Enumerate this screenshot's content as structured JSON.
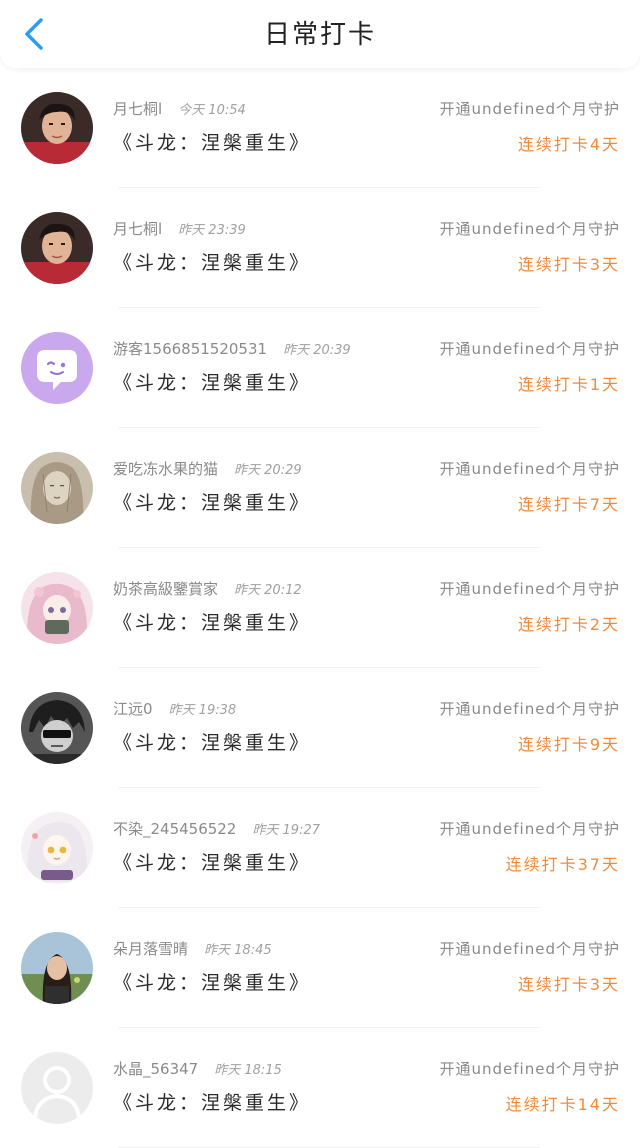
{
  "header": {
    "title": "日常打卡",
    "back_icon": "chevron-left-icon",
    "accent": "#2d9cf0"
  },
  "colors": {
    "streak": "#f08a3c",
    "meta": "#8a8a8a"
  },
  "items": [
    {
      "user": "月七桐l",
      "time": "今天 10:54",
      "book": "《斗龙：涅槃重生》",
      "guard": "开通undefined个月守护",
      "streak": "连续打卡4天",
      "avatar": "photo-boy"
    },
    {
      "user": "月七桐l",
      "time": "昨天 23:39",
      "book": "《斗龙：涅槃重生》",
      "guard": "开通undefined个月守护",
      "streak": "连续打卡3天",
      "avatar": "photo-boy"
    },
    {
      "user": "游客1566851520531",
      "time": "昨天 20:39",
      "book": "《斗龙：涅槃重生》",
      "guard": "开通undefined个月守护",
      "streak": "连续打卡1天",
      "avatar": "chat-bubble"
    },
    {
      "user": "爱吃冻水果的猫",
      "time": "昨天 20:29",
      "book": "《斗龙：涅槃重生》",
      "guard": "开通undefined个月守护",
      "streak": "连续打卡7天",
      "avatar": "sketch-girl"
    },
    {
      "user": "奶茶高級鑒賞家",
      "time": "昨天 20:12",
      "book": "《斗龙：涅槃重生》",
      "guard": "开通undefined个月守护",
      "streak": "连续打卡2天",
      "avatar": "anime-pink"
    },
    {
      "user": "江远0",
      "time": "昨天 19:38",
      "book": "《斗龙：涅槃重生》",
      "guard": "开通undefined个月守护",
      "streak": "连续打卡9天",
      "avatar": "manga-bw"
    },
    {
      "user": "不染_245456522",
      "time": "昨天 19:27",
      "book": "《斗龙：涅槃重生》",
      "guard": "开通undefined个月守护",
      "streak": "连续打卡37天",
      "avatar": "anime-white"
    },
    {
      "user": "朵月落雪晴",
      "time": "昨天 18:45",
      "book": "《斗龙：涅槃重生》",
      "guard": "开通undefined个月守护",
      "streak": "连续打卡3天",
      "avatar": "photo-girl"
    },
    {
      "user": "水晶_56347",
      "time": "昨天 18:15",
      "book": "《斗龙：涅槃重生》",
      "guard": "开通undefined个月守护",
      "streak": "连续打卡14天",
      "avatar": "default-user"
    }
  ]
}
